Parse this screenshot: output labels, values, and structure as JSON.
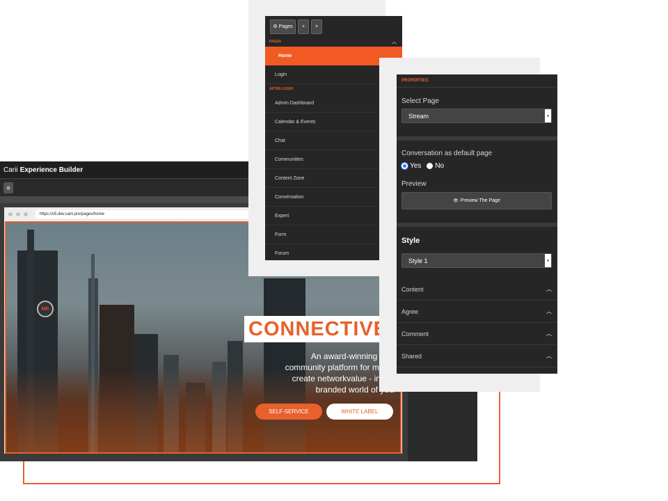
{
  "builder": {
    "title_prefix": "Carii",
    "title_bold": "Experience Builder",
    "menu_icon": "≡"
  },
  "browser": {
    "url": "https://v5.dev.carii.pro/pages/home"
  },
  "hero": {
    "logo_text": "MR",
    "title": "CONNECTIVE",
    "text": "An award-winning end to\ncommunity platform for member\ncreate networkvalue - in a sec\nbranded world of your c",
    "button_primary": "SELF-SERVICE",
    "button_secondary": "WHITE LABEL"
  },
  "pages_panel": {
    "pages_button": "Pages",
    "pages_icon": "⚙",
    "add_icon": "+",
    "close_icon": "×",
    "section_pages": "PAGES",
    "section_after_login": "AFTER LOGIN",
    "collapse_icon": "︿",
    "pages": [
      {
        "label": "Home"
      },
      {
        "label": "Login"
      }
    ],
    "after_login": [
      {
        "label": "Admin Dashboard"
      },
      {
        "label": "Calendar & Events"
      },
      {
        "label": "Chat"
      },
      {
        "label": "Communities"
      },
      {
        "label": "Content Zone"
      },
      {
        "label": "Conversation"
      },
      {
        "label": "Expert"
      },
      {
        "label": "Form"
      },
      {
        "label": "Forum"
      }
    ]
  },
  "properties": {
    "title": "PROPERTIES",
    "select_page_label": "Select Page",
    "select_page_value": "Stream",
    "dropdown_arrow": "▾",
    "default_label": "Conversation as default page",
    "yes": "Yes",
    "no": "No",
    "preview_label": "Preview",
    "preview_button": "Preview The Page",
    "preview_icon": "👁",
    "style_label": "Style",
    "style_value": "Style 1",
    "chevron_up": "︿",
    "accordions": [
      {
        "label": "Content"
      },
      {
        "label": "Agree"
      },
      {
        "label": "Comment"
      },
      {
        "label": "Shared"
      }
    ]
  }
}
